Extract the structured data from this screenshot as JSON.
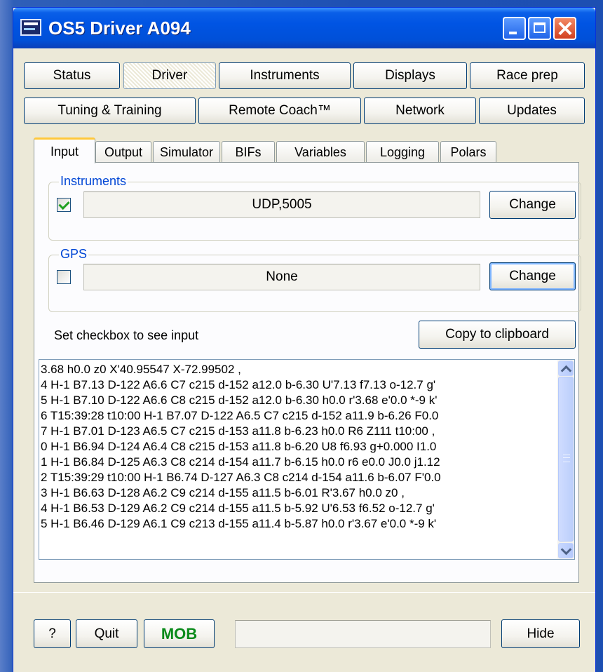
{
  "window": {
    "title": "OS5 Driver A094"
  },
  "nav": {
    "row1": [
      "Status",
      "Driver",
      "Instruments",
      "Displays",
      "Race prep"
    ],
    "row2": [
      "Tuning & Training",
      "Remote Coach™",
      "Network",
      "Updates"
    ],
    "active": "Driver"
  },
  "tabs": {
    "items": [
      "Input",
      "Output",
      "Simulator",
      "BIFs",
      "Variables",
      "Logging",
      "Polars"
    ],
    "active": "Input"
  },
  "instruments": {
    "legend": "Instruments",
    "checked": true,
    "value": "UDP,5005",
    "change_label": "Change"
  },
  "gps": {
    "legend": "GPS",
    "checked": false,
    "value": "None",
    "change_label": "Change"
  },
  "status": {
    "hint": "Set checkbox to see input",
    "copy_label": "Copy to clipboard"
  },
  "log": {
    "lines": [
      "3.68 h0.0 z0 X'40.95547 X-72.99502 ,",
      "4 H-1 B7.13 D-122 A6.6 C7 c215 d-152 a12.0 b-6.30 U'7.13 f7.13 o-12.7 g'",
      "5 H-1 B7.10 D-122 A6.6 C8 c215 d-152 a12.0 b-6.30 h0.0 r'3.68 e'0.0 *-9 k'",
      "6 T15:39:28 t10:00 H-1 B7.07 D-122 A6.5 C7 c215 d-152 a11.9 b-6.26 F0.0",
      "7 H-1 B7.01 D-123 A6.5 C7 c215 d-153 a11.8 b-6.23 h0.0 R6 Z111 t10:00 ,",
      "0 H-1 B6.94 D-124 A6.4 C8 c215 d-153 a11.8 b-6.20 U8 f6.93 g+0.000 I1.0",
      "1 H-1 B6.84 D-125 A6.3 C8 c214 d-154 a11.7 b-6.15 h0.0 r6 e0.0 J0.0 j1.12",
      "2 T15:39:29 t10:00 H-1 B6.74 D-127 A6.3 C8 c214 d-154 a11.6 b-6.07 F'0.0",
      "3 H-1 B6.63 D-128 A6.2 C9 c214 d-155 a11.5 b-6.01 R'3.67 h0.0 z0 ,",
      "4 H-1 B6.53 D-129 A6.2 C9 c214 d-155 a11.5 b-5.92 U'6.53 f6.52 o-12.7 g'",
      "5 H-1 B6.46 D-129 A6.1 C9 c213 d-155 a11.4 b-5.87 h0.0 r'3.67 e'0.0 *-9 k'"
    ]
  },
  "footer": {
    "help_label": "?",
    "quit_label": "Quit",
    "mob_label": "MOB",
    "status_value": "",
    "hide_label": "Hide"
  },
  "colors": {
    "accent_tab": "#ffc83c",
    "legend": "#0046d5",
    "mob": "#0a8a1a",
    "titlebar": "#0054e3"
  }
}
